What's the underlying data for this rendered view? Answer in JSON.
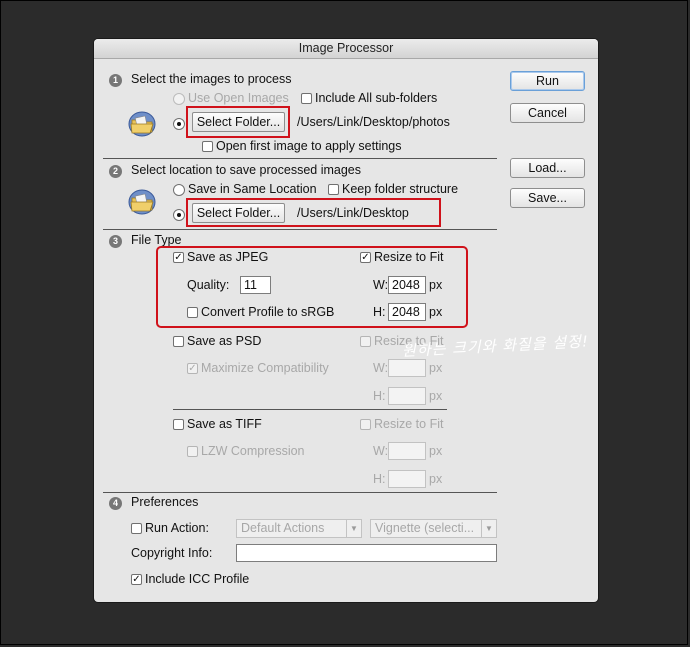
{
  "window": {
    "title": "Image Processor"
  },
  "sections": {
    "s1": {
      "num": "1",
      "title": "Select the images to process"
    },
    "s2": {
      "num": "2",
      "title": "Select location to save processed images"
    },
    "s3": {
      "num": "3",
      "title": "File Type"
    },
    "s4": {
      "num": "4",
      "title": "Preferences"
    }
  },
  "source": {
    "use_open_images": "Use Open Images",
    "include_subfolders": "Include All sub-folders",
    "select_folder": "Select Folder...",
    "path": "/Users/Link/Desktop/photos",
    "open_first": "Open first image to apply settings"
  },
  "destination": {
    "save_same": "Save in Same Location",
    "keep_structure": "Keep folder structure",
    "select_folder": "Select Folder...",
    "path": "/Users/Link/Desktop"
  },
  "jpeg": {
    "save_as": "Save as JPEG",
    "resize": "Resize to Fit",
    "quality_label": "Quality:",
    "quality": "11",
    "w_label": "W:",
    "w": "2048",
    "px": "px",
    "h_label": "H:",
    "h": "2048",
    "convert": "Convert Profile to sRGB"
  },
  "psd": {
    "save_as": "Save as PSD",
    "resize": "Resize to Fit",
    "maximize": "Maximize Compatibility",
    "w_label": "W:",
    "h_label": "H:",
    "px": "px"
  },
  "tiff": {
    "save_as": "Save as TIFF",
    "resize": "Resize to Fit",
    "lzw": "LZW Compression",
    "w_label": "W:",
    "h_label": "H:",
    "px": "px"
  },
  "prefs": {
    "run_action": "Run Action:",
    "action_set": "Default Actions",
    "action": "Vignette (selecti...",
    "copyright": "Copyright Info:",
    "copyright_value": "",
    "icc": "Include ICC Profile"
  },
  "buttons": {
    "run": "Run",
    "cancel": "Cancel",
    "load": "Load...",
    "save": "Save..."
  },
  "annotation": "원하는 크기와 화질을 설정!",
  "colors": {
    "highlight": "#d0121b",
    "default_button": "#6aa0d8"
  }
}
